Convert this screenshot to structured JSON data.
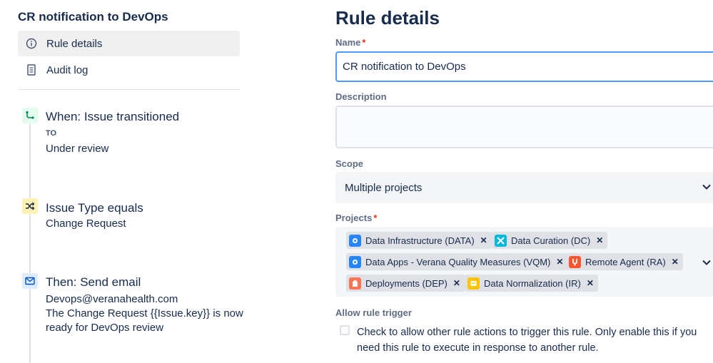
{
  "sidebar": {
    "rule_title": "CR notification to DevOps",
    "nav": [
      {
        "label": "Rule details",
        "icon": "info-icon",
        "active": true
      },
      {
        "label": "Audit log",
        "icon": "document-icon",
        "active": false
      }
    ]
  },
  "timeline": {
    "trigger": {
      "title": "When: Issue transitioned",
      "sub_label": "TO",
      "value": "Under review",
      "icon": "transition-icon",
      "color": "#e3fcef"
    },
    "condition": {
      "title": "Issue Type equals",
      "value": "Change Request",
      "icon": "shuffle-icon",
      "color": "#fff0b3"
    },
    "action": {
      "title": "Then: Send email",
      "line1": "Devops@veranahealth.com",
      "line2": "The Change Request {{Issue.key}} is now",
      "line3": "ready for DevOps review",
      "icon": "email-icon",
      "color": "#deebff"
    }
  },
  "form": {
    "page_title": "Rule details",
    "name_label": "Name",
    "name_required": "*",
    "name_value": "CR notification to DevOps",
    "description_label": "Description",
    "scope_label": "Scope",
    "scope_value": "Multiple projects",
    "projects_label": "Projects",
    "projects_required": "*",
    "projects": [
      {
        "label": "Data Infrastructure (DATA)",
        "avatar_color": "#2684ff"
      },
      {
        "label": "Data Curation (DC)",
        "avatar_color": "#00b8d9"
      },
      {
        "label": "Data Apps - Verana Quality Measures (VQM)",
        "avatar_color": "#2684ff"
      },
      {
        "label": "Remote Agent (RA)",
        "avatar_color": "#ff5630"
      },
      {
        "label": "Deployments (DEP)",
        "avatar_color": "#ff7452"
      },
      {
        "label": "Data Normalization (IR)",
        "avatar_color": "#ffc400"
      }
    ],
    "allow_trigger_label": "Allow rule trigger",
    "allow_trigger_text_1": "Check to allow other rule actions to trigger this rule. Only enable this if you",
    "allow_trigger_text_2": "need this rule to execute in response to another rule."
  },
  "colors": {
    "accent": "#4c9aff",
    "required": "#de350b",
    "text": "#172b4d"
  }
}
